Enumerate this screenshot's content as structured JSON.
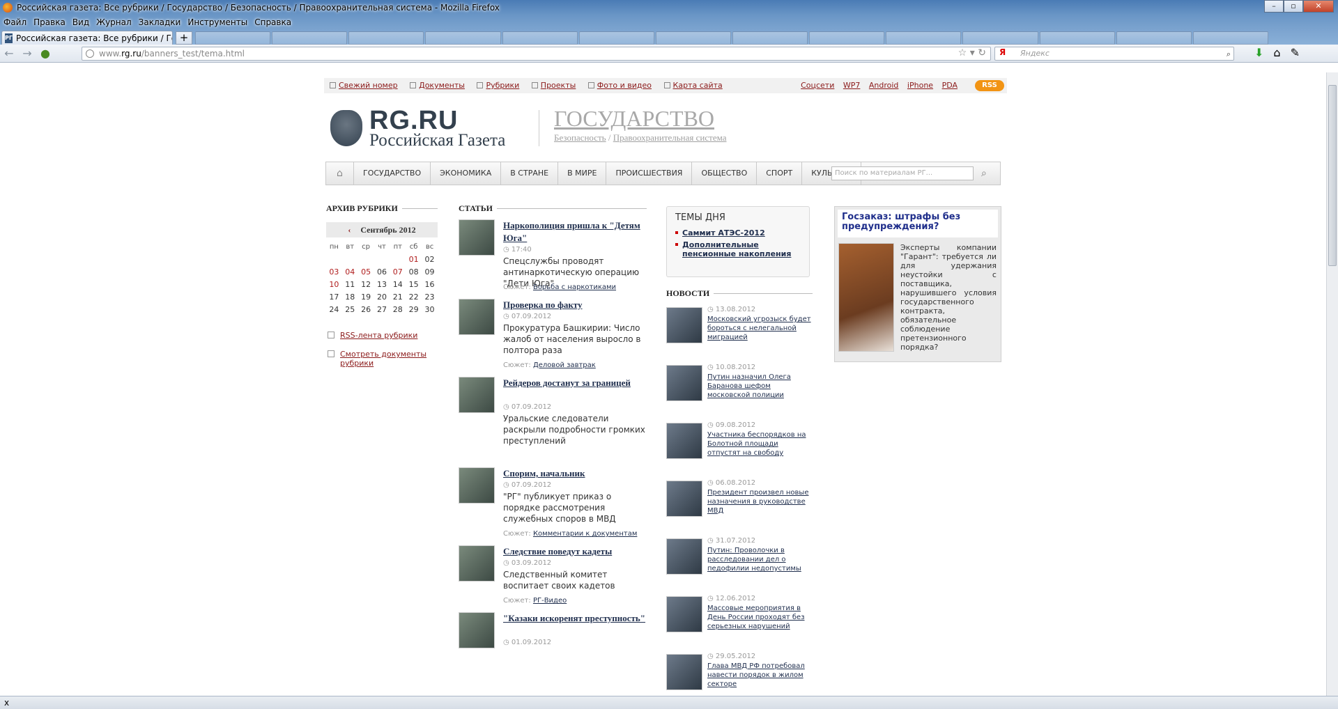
{
  "browser": {
    "window_title": "Российская газета: Все рубрики / Государство / Безопасность / Правоохранительная система - Mozilla Firefox",
    "menu": [
      "Файл",
      "Правка",
      "Вид",
      "Журнал",
      "Закладки",
      "Инструменты",
      "Справка"
    ],
    "active_tab": "Российская газета: Все рубрики / Госу...",
    "url_prefix": "www.",
    "url_host": "rg.ru",
    "url_path": "/banners_test/tema.html",
    "search_placeholder": "Яндекс",
    "search_engine": "Я",
    "status": "x"
  },
  "site": {
    "top_links_left": [
      "Свежий номер",
      "Документы",
      "Рубрики",
      "Проекты",
      "Фото и видео",
      "Карта сайта"
    ],
    "top_links_right": [
      "Соцсети",
      "WP7",
      "Android",
      "iPhone",
      "PDA"
    ],
    "rss_label": "RSS",
    "logo_rg": "RG.RU",
    "logo_name": "Российская Газета",
    "section_title": "ГОСУДАРСТВО",
    "section_sub_1": "Безопасность",
    "section_sub_sep": " / ",
    "section_sub_2": "Правоохранительная система",
    "nav": [
      "ГОСУДАРСТВО",
      "ЭКОНОМИКА",
      "В СТРАНЕ",
      "В МИРЕ",
      "ПРОИСШЕСТВИЯ",
      "ОБЩЕСТВО",
      "СПОРТ",
      "КУЛЬТУРА"
    ],
    "nav_search_placeholder": "Поиск по материалам РГ..."
  },
  "archive": {
    "title": "АРХИВ РУБРИКИ",
    "month": "Сентябрь 2012",
    "weekdays": [
      "пн",
      "вт",
      "ср",
      "чт",
      "пт",
      "сб",
      "вс"
    ],
    "weeks": [
      [
        "",
        "",
        "",
        "",
        "",
        "01",
        "02"
      ],
      [
        "03",
        "04",
        "05",
        "06",
        "07",
        "08",
        "09"
      ],
      [
        "10",
        "11",
        "12",
        "13",
        "14",
        "15",
        "16"
      ],
      [
        "17",
        "18",
        "19",
        "20",
        "21",
        "22",
        "23"
      ],
      [
        "24",
        "25",
        "26",
        "27",
        "28",
        "29",
        "30"
      ]
    ],
    "linked_days": [
      "01",
      "03",
      "04",
      "05",
      "07",
      "10"
    ],
    "rss_link": "RSS-лента рубрики",
    "docs_link": "Смотреть документы рубрики"
  },
  "articles": {
    "title": "СТАТЬИ",
    "plot_label": "Сюжет:",
    "items": [
      {
        "title": "Наркополиция пришла к \"Детям Юга\"",
        "date": "17:40",
        "lead": "Спецслужбы проводят антинаркотическую операцию \"Дети Юга\"",
        "plot": "Борьба с наркотиками"
      },
      {
        "title": "Проверка по факту",
        "date": "07.09.2012",
        "lead": "Прокуратура Башкирии: Число жалоб от населения выросло в полтора раза",
        "plot": "Деловой завтрак"
      },
      {
        "title": "Рейдеров достанут за границей",
        "date": "07.09.2012",
        "lead": "Уральские следователи раскрыли подробности громких преступлений",
        "plot": ""
      },
      {
        "title": "Спорим, начальник",
        "date": "07.09.2012",
        "lead": "\"РГ\" публикует приказ о порядке рассмотрения служебных споров в МВД",
        "plot": "Комментарии к документам"
      },
      {
        "title": "Следствие поведут кадеты",
        "date": "03.09.2012",
        "lead": "Следственный комитет воспитает своих кадетов",
        "plot": "РГ-Видео"
      },
      {
        "title": "\"Казаки искоренят преступность\"",
        "date": "01.09.2012",
        "lead": "",
        "plot": ""
      }
    ]
  },
  "themes": {
    "title": "ТЕМЫ ДНЯ",
    "items": [
      "Саммит АТЭС-2012",
      "Дополнительные пенсионные накопления"
    ]
  },
  "news": {
    "title": "НОВОСТИ",
    "items": [
      {
        "date": "13.08.2012",
        "title": "Московский угрозыск будет бороться с нелегальной миграцией"
      },
      {
        "date": "10.08.2012",
        "title": "Путин назначил Олега Баранова шефом московской полиции"
      },
      {
        "date": "09.08.2012",
        "title": "Участника беспорядков на Болотной площади отпустят на свободу"
      },
      {
        "date": "06.08.2012",
        "title": "Президент произвел новые назначения в руководстве МВД"
      },
      {
        "date": "31.07.2012",
        "title": "Путин: Проволочки в расследовании дел о педофилии недопустимы"
      },
      {
        "date": "12.06.2012",
        "title": "Массовые мероприятия в День России проходят без серьезных нарушений"
      },
      {
        "date": "29.05.2012",
        "title": "Глава МВД РФ потребовал навести порядок в жилом секторе"
      }
    ]
  },
  "banner": {
    "title": "Госзаказ: штрафы без предупреждения?",
    "text": "Эксперты компании \"Гарант\": требуется ли для удержания неустойки с поставщика, нарушившего условия государственного контракта, обязательное соблюдение претензионного порядка?"
  }
}
